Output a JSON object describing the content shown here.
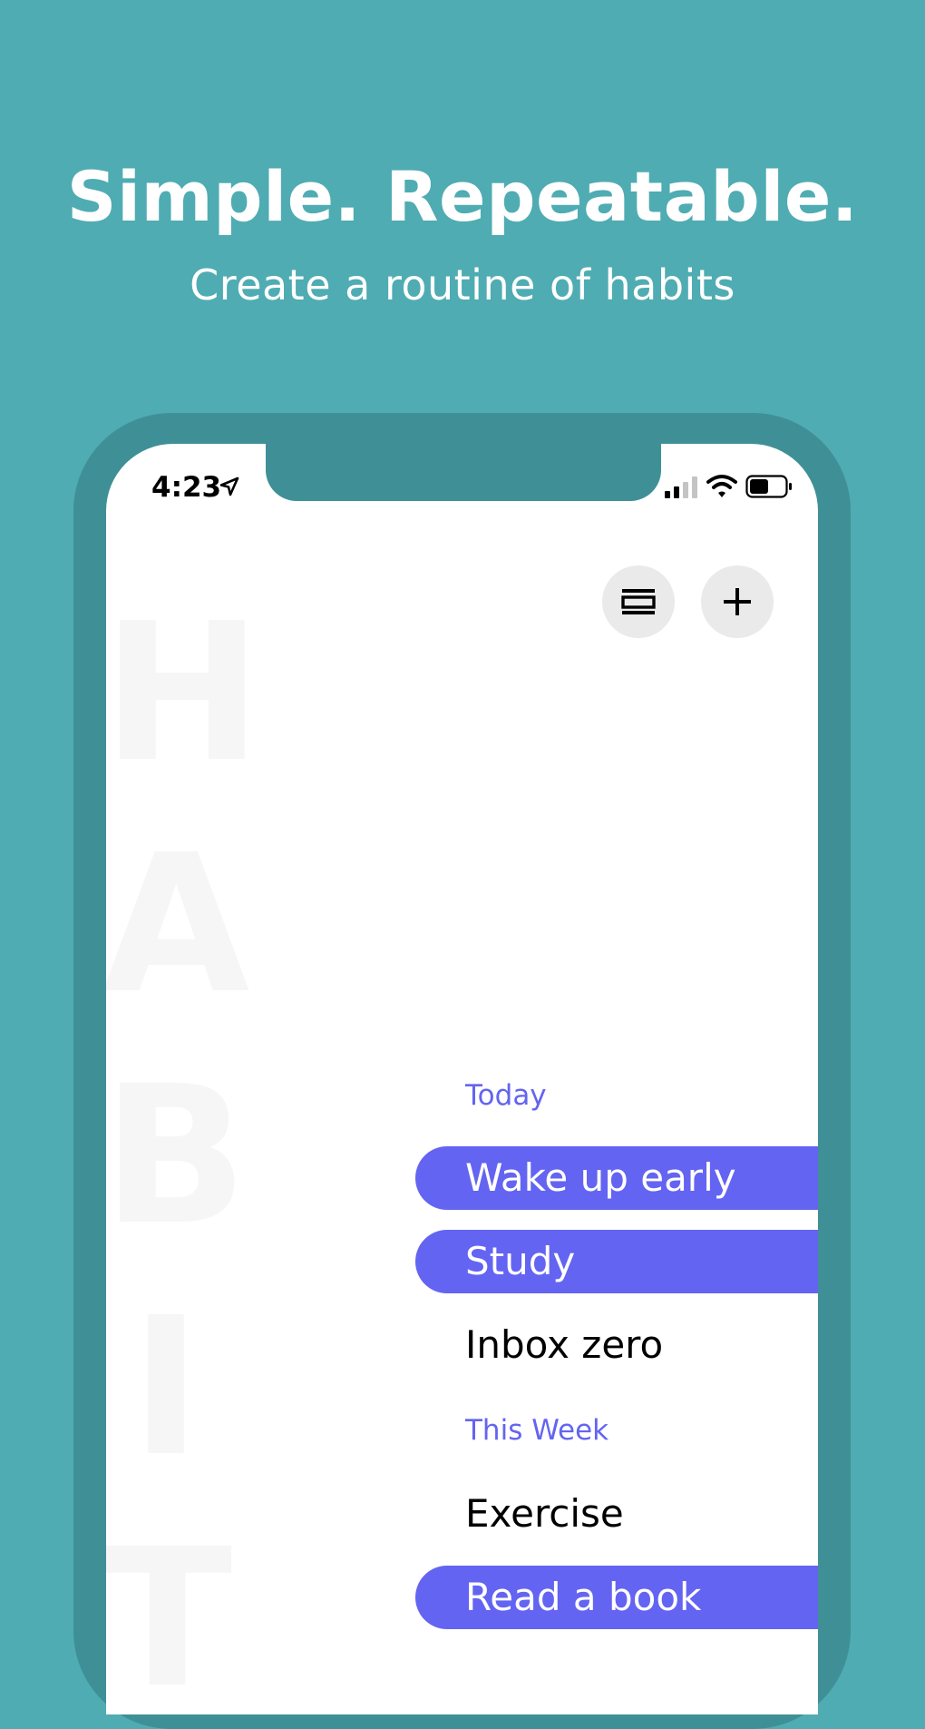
{
  "promo": {
    "headline": "Simple. Repeatable.",
    "subline": "Create a routine of habits"
  },
  "status_bar": {
    "time": "4:23"
  },
  "watermark": {
    "letters": [
      "H",
      "A",
      "B",
      "I",
      "T"
    ]
  },
  "toolbar": {
    "buttons": [
      {
        "name": "layout-icon"
      },
      {
        "name": "plus-icon"
      }
    ]
  },
  "sections": [
    {
      "title": "Today",
      "habits": [
        {
          "label": "Wake up early",
          "done": true
        },
        {
          "label": "Study",
          "done": true
        },
        {
          "label": "Inbox zero",
          "done": false
        }
      ]
    },
    {
      "title": "This Week",
      "habits": [
        {
          "label": "Exercise",
          "done": false
        },
        {
          "label": "Read a book",
          "done": true
        }
      ]
    }
  ],
  "colors": {
    "background": "#4FACB2",
    "frame": "#3F9096",
    "accent": "#6464F2",
    "button": "#EAEAEA"
  }
}
